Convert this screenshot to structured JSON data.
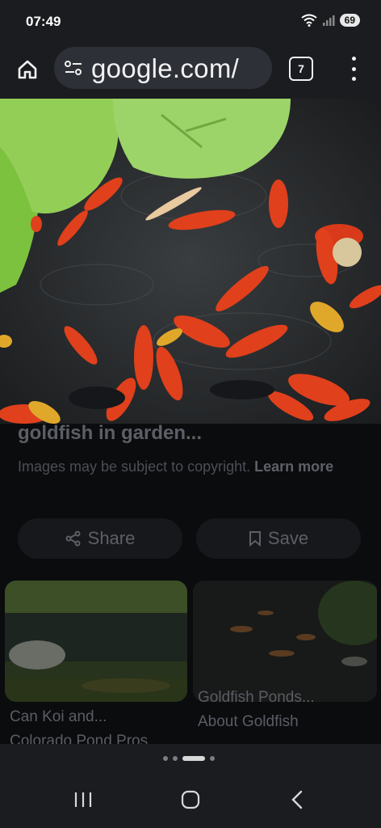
{
  "status_bar": {
    "time": "07:49",
    "battery": "69",
    "icons": [
      "wifi-icon",
      "signal-icon",
      "battery-icon"
    ]
  },
  "toolbar": {
    "url": "google.com/",
    "tab_count": "7",
    "icons": [
      "home-icon",
      "tune-icon",
      "more-vert-icon"
    ]
  },
  "result": {
    "title": "goldfish in garden...",
    "copyright_text": "Images may be subject to copyright.",
    "learn_more": "Learn more",
    "share_label": "Share",
    "save_label": "Save"
  },
  "related": [
    {
      "caption_line1": "Can Koi and...",
      "caption_line2": "Colorado Pond Pros"
    },
    {
      "caption_line1": "Goldfish Ponds...",
      "caption_line2": "About Goldfish"
    }
  ],
  "page_indicator": {
    "count": 4,
    "active": 2
  },
  "colors": {
    "background": "#0b0c0e",
    "bar": "#1b1c20",
    "omnibox": "#2e3038"
  }
}
